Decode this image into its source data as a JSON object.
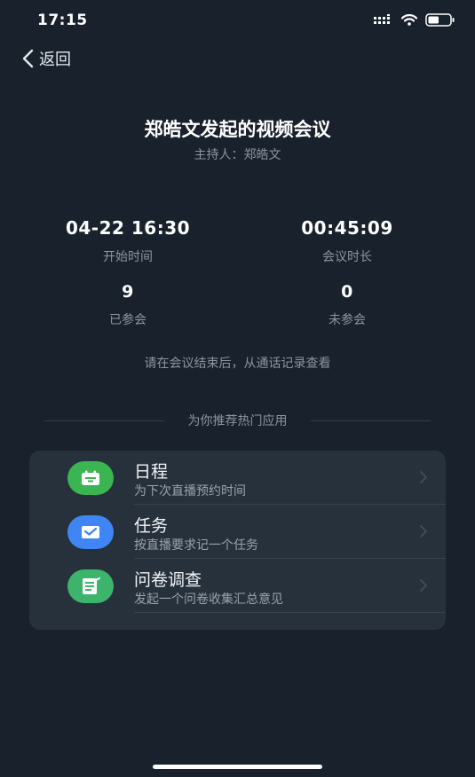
{
  "status_bar": {
    "time": "17:15",
    "icons": [
      "signal-icon",
      "wifi-icon",
      "battery-icon"
    ],
    "battery_level": 0.5
  },
  "nav": {
    "back_label": "返回"
  },
  "meeting": {
    "title": "郑皓文发起的视频会议",
    "host": "主持人：郑皓文"
  },
  "stats": {
    "start_time": {
      "value": "04-22 16:30",
      "label": "开始时间"
    },
    "duration": {
      "value": "00:45:09",
      "label": "会议时长"
    },
    "attended": {
      "value": "9",
      "label": "已参会"
    },
    "absent": {
      "value": "0",
      "label": "未参会"
    }
  },
  "notice": "请在会议结束后，从通话记录查看",
  "recommend_title": "为你推荐热门应用",
  "apps": [
    {
      "name": "日程",
      "desc": "为下次直播预约时间",
      "icon": "calendar-icon",
      "color": "#3ab552"
    },
    {
      "name": "任务",
      "desc": "按直播要求记一个任务",
      "icon": "mail-icon",
      "color": "#3f86f4"
    },
    {
      "name": "问卷调查",
      "desc": "发起一个问卷收集汇总意见",
      "icon": "survey-icon",
      "color": "#3db46b"
    }
  ],
  "colors": {
    "background": "#18212c",
    "card": "#27313c",
    "muted_text": "#8c95a1"
  }
}
